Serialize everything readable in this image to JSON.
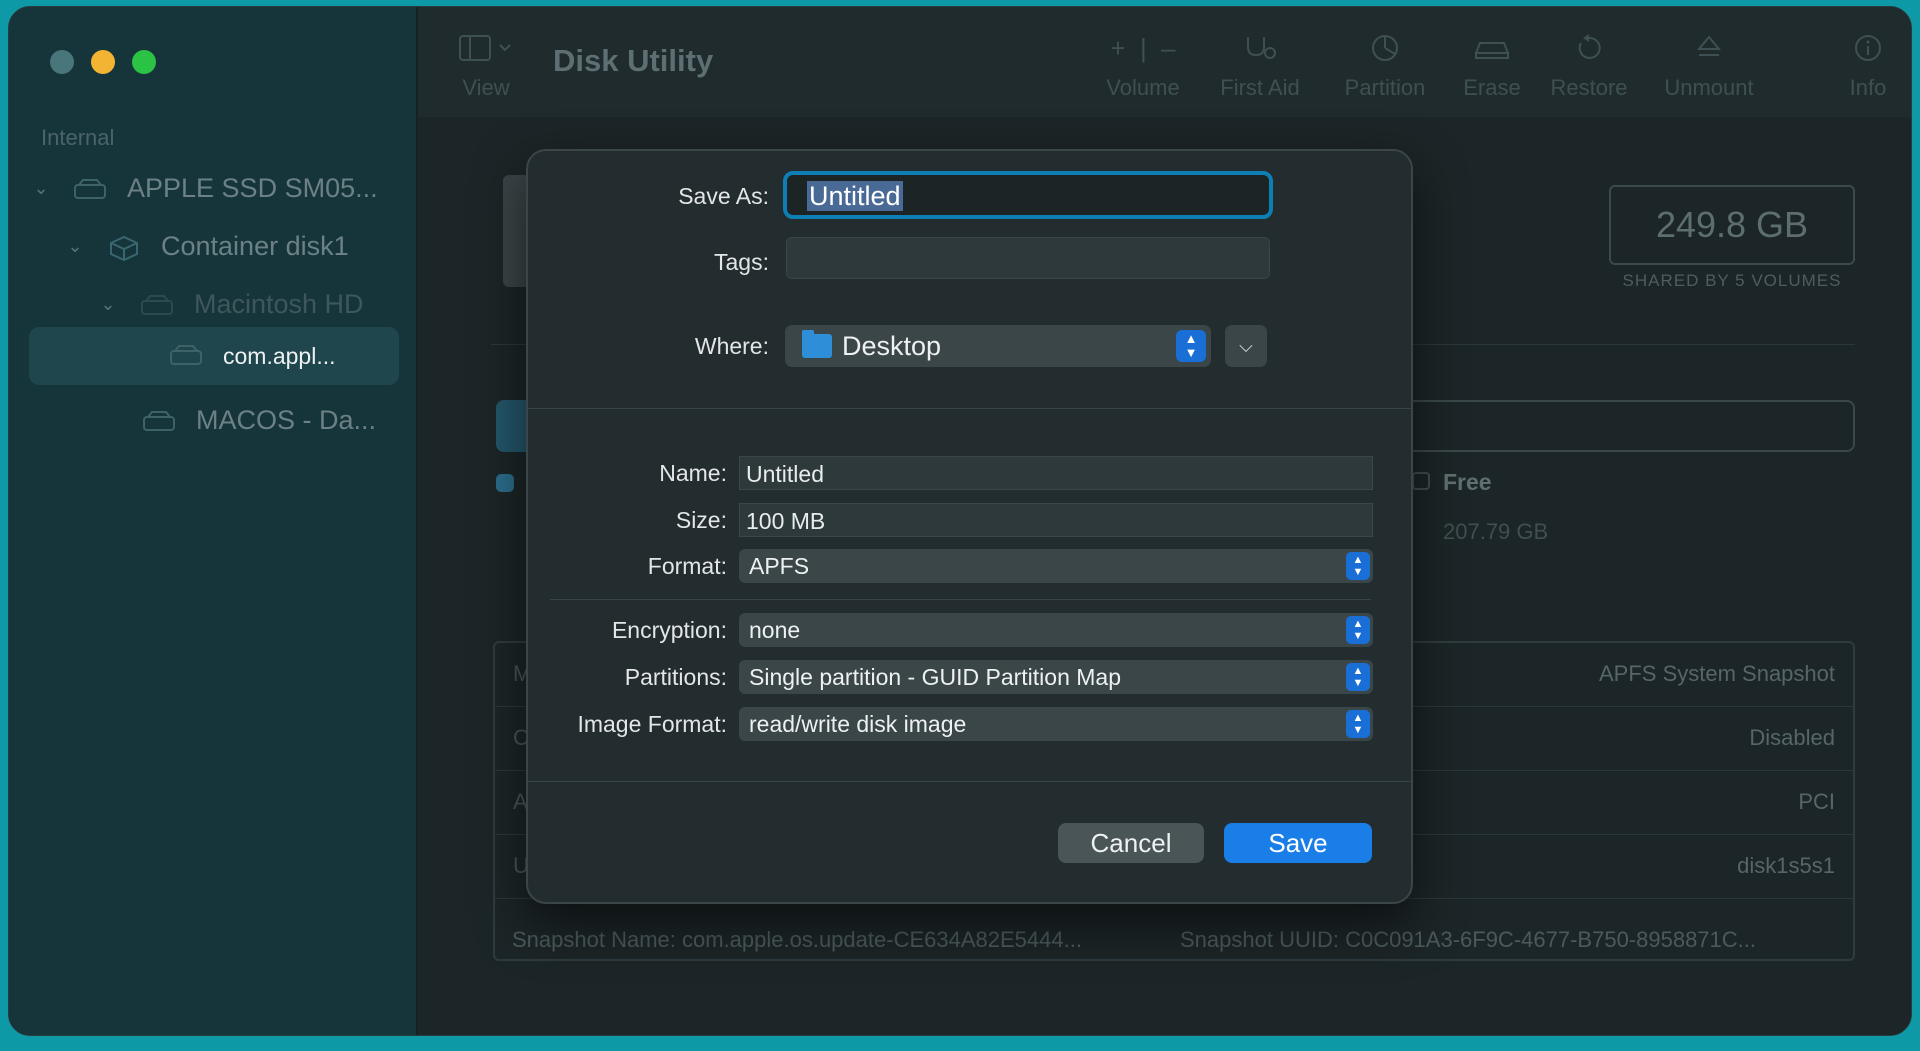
{
  "window": {
    "title": "Disk Utility",
    "traffic_lights": {
      "close": "#49767a",
      "minimize": "#f3b433",
      "maximize": "#2bc344"
    }
  },
  "toolbar": {
    "view_label": "View",
    "buttons": [
      {
        "label": "Volume",
        "icon": "plus-minus-icon"
      },
      {
        "label": "First Aid",
        "icon": "stethoscope-icon"
      },
      {
        "label": "Partition",
        "icon": "pie-chart-icon"
      },
      {
        "label": "Erase",
        "icon": "erase-car-icon"
      },
      {
        "label": "Restore",
        "icon": "restore-arrow-icon"
      },
      {
        "label": "Unmount",
        "icon": "eject-icon"
      },
      {
        "label": "Info",
        "icon": "info-icon"
      }
    ]
  },
  "sidebar": {
    "section": "Internal",
    "items": [
      {
        "label": "APPLE SSD SM05...",
        "icon": "drive-icon"
      },
      {
        "label": "Container disk1",
        "icon": "container-icon"
      },
      {
        "label": "Macintosh HD",
        "icon": "volume-icon"
      },
      {
        "label": "com.appl...",
        "icon": "volume-icon"
      },
      {
        "label": "MACOS - Da...",
        "icon": "volume-icon"
      }
    ]
  },
  "main": {
    "capacity": "249.8 GB",
    "capacity_sub": "SHARED BY 5 VOLUMES",
    "free_label": "Free",
    "free_value": "207.79 GB",
    "info_rows": [
      {
        "left": "M",
        "right": "APFS System Snapshot"
      },
      {
        "left": "C",
        "right": "Disabled"
      },
      {
        "left": "A",
        "right": "PCI"
      },
      {
        "left": "U",
        "right": "disk1s5s1"
      }
    ],
    "snapshot_name": "Snapshot Name:   com.apple.os.update-CE634A82E5444...",
    "snapshot_uuid": "Snapshot UUID:   C0C091A3-6F9C-4677-B750-8958871C..."
  },
  "dialog": {
    "save_as_label": "Save As:",
    "save_as_value": "Untitled",
    "tags_label": "Tags:",
    "where_label": "Where:",
    "where_value": "Desktop",
    "name_label": "Name:",
    "name_value": "Untitled",
    "size_label": "Size:",
    "size_value": "100 MB",
    "format_label": "Format:",
    "format_value": "APFS",
    "encryption_label": "Encryption:",
    "encryption_value": "none",
    "partitions_label": "Partitions:",
    "partitions_value": "Single partition - GUID Partition Map",
    "image_format_label": "Image Format:",
    "image_format_value": "read/write disk image",
    "cancel_label": "Cancel",
    "save_label": "Save"
  }
}
